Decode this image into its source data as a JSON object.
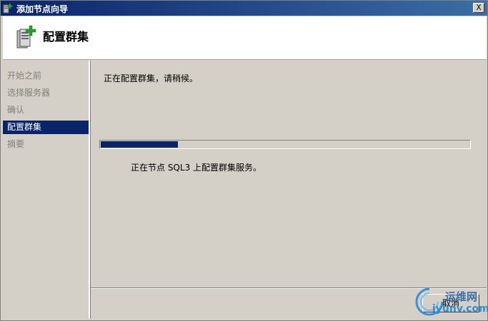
{
  "window": {
    "title": "添加节点向导",
    "close_glyph": "X"
  },
  "header": {
    "title": "配置群集",
    "icon": "server-add-icon"
  },
  "sidebar": {
    "items": [
      {
        "label": "开始之前",
        "active": false
      },
      {
        "label": "选择服务器",
        "active": false
      },
      {
        "label": "确认",
        "active": false
      },
      {
        "label": "配置群集",
        "active": true
      },
      {
        "label": "摘要",
        "active": false
      }
    ]
  },
  "main": {
    "status": "正在配置群集，请稍候。",
    "progress_fraction": 0.21,
    "detail": "正在节点 SQL3 上配置群集服务。"
  },
  "footer": {
    "cancel_label": "取消"
  },
  "watermark": {
    "text_cn": "运维网",
    "text_en": "iyunv.com"
  },
  "colors": {
    "accent": "#0a246a",
    "background": "#d4d0c8"
  }
}
